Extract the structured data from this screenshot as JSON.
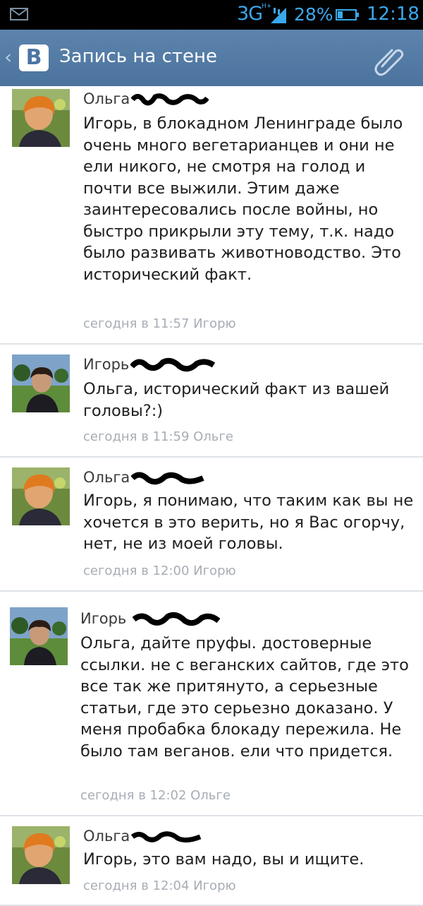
{
  "statusbar": {
    "network": "3G",
    "network_sub": "H+",
    "battery": "28%",
    "battery_level": 0.28,
    "time": "12:18"
  },
  "actionbar": {
    "logo": "B",
    "title": "Запись на стене"
  },
  "icons": {
    "mail": "mail-icon",
    "signal": "signal-icon",
    "battery": "battery-icon",
    "back": "back-chevron-icon",
    "attach": "paperclip-icon"
  },
  "colors": {
    "actionbar": "#4f77a1",
    "status_accent": "#3aa8ec",
    "meta_text": "#a7adb5"
  },
  "comments": [
    {
      "author": "Ольга",
      "text": "Игорь, в блокадном Ленинграде было очень много вегетарианцев и они не ели никого, не смотря на голод и почти все выжили. Этим даже заинтересовались после войны, но быстро прикрыли эту тему, т.к. надо было развивать животноводство. Это исторический факт.",
      "meta": "сегодня в 11:57 Игорю"
    },
    {
      "author": "Игорь",
      "text": "Ольга, исторический факт из вашей головы?:)",
      "meta": "сегодня в 11:59 Ольге"
    },
    {
      "author": "Ольга",
      "text": "Игорь, я понимаю, что таким как вы не хочется в это верить, но я Вас огорчу, нет, не из моей головы.",
      "meta": "сегодня в 12:00 Игорю"
    },
    {
      "author": "Игорь",
      "text": "Ольга, дайте пруфы. достоверные ссылки. не с веганских сайтов, где это все так же притянуто, а серьезные статьи, где это серьезно доказано. У меня пробабка блокаду пережила. Не было там веганов. ели что придется.",
      "meta": "сегодня в 12:02 Ольге"
    },
    {
      "author": "Ольга",
      "text": "Игорь, это вам надо, вы и ищите.",
      "meta": "сегодня в 12:04 Игорю"
    }
  ]
}
